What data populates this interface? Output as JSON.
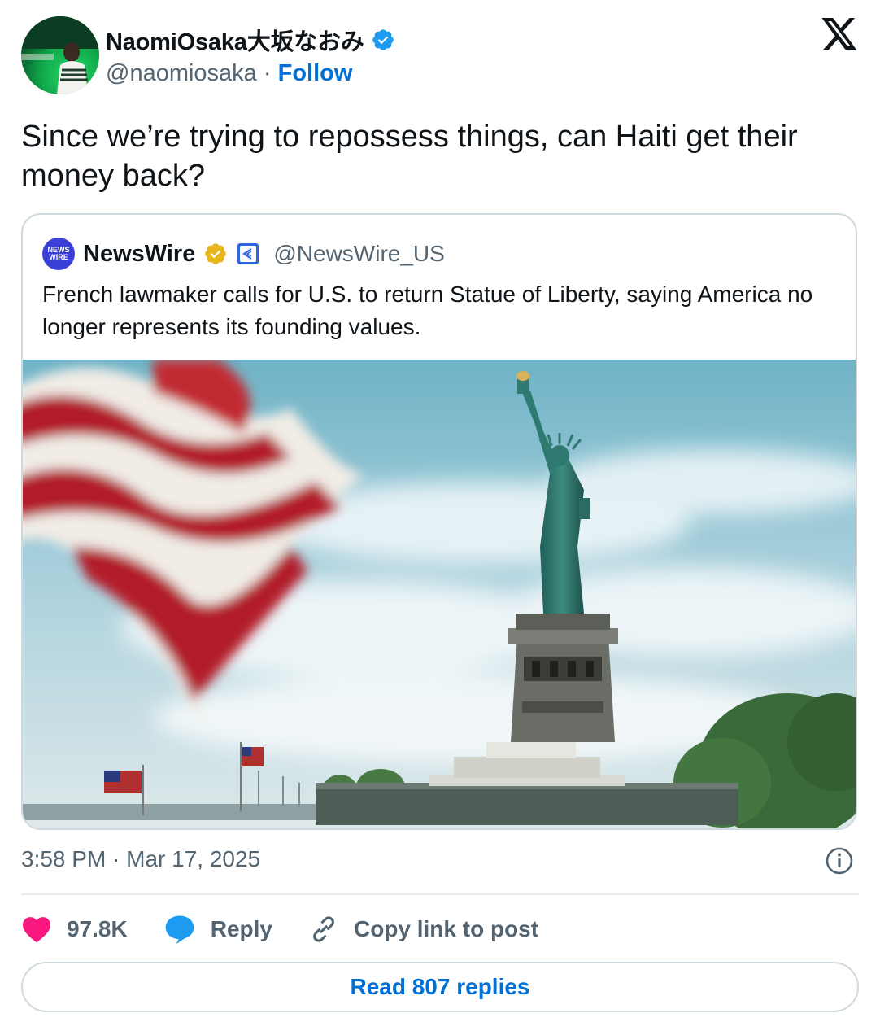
{
  "author": {
    "display_name": "NaomiOsaka大坂なおみ",
    "handle": "@naomiosaka",
    "separator": "·",
    "follow_label": "Follow",
    "verified_color": "#1d9bf0"
  },
  "tweet": {
    "text": "Since we’re trying to repossess things, can Haiti get their money back?"
  },
  "quoted_tweet": {
    "logo_text_top": "NEWS",
    "logo_text_bottom": "WIRE",
    "display_name": "NewsWire",
    "handle": "@NewsWire_US",
    "verified_color": "#e8b51a",
    "text": "French lawmaker calls for U.S. to return Statue of Liberty, saying America no longer represents its founding values.",
    "image_description_icon": "statue-of-liberty-photo"
  },
  "meta": {
    "timestamp": "3:58 PM · Mar 17, 2025"
  },
  "actions": {
    "like_count": "97.8K",
    "reply_label": "Reply",
    "copy_link_label": "Copy link to post"
  },
  "read_replies_label": "Read 807 replies",
  "colors": {
    "like": "#f91880",
    "reply": "#1d9bf0",
    "link": "#006fd6",
    "muted": "#536471"
  }
}
